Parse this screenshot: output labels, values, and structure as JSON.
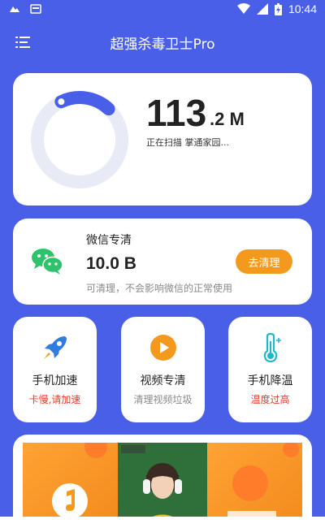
{
  "status_bar": {
    "time": "10:44",
    "icons": [
      "notification-icon",
      "notification-icon",
      "wifi-icon",
      "signal-icon",
      "battery-icon"
    ]
  },
  "header": {
    "title": "超强杀毒卫士Pro",
    "menu_icon": "menu-icon"
  },
  "scan": {
    "size_value": "113",
    "size_unit": ".2 M",
    "status_text": "正在扫描 掌通家园...",
    "progress": 0.12
  },
  "wechat": {
    "title": "微信专清",
    "size": "10.0 B",
    "description": "可清理，不会影响微信的正常使用",
    "button_label": "去清理",
    "icon": "wechat-icon"
  },
  "tiles": [
    {
      "title": "手机加速",
      "subtitle": "卡慢,请加速",
      "subtitle_color": "#e23a2e",
      "icon": "rocket-icon"
    },
    {
      "title": "视频专清",
      "subtitle": "清理视频垃圾",
      "subtitle_color": "#888888",
      "icon": "play-icon"
    },
    {
      "title": "手机降温",
      "subtitle": "温度过高",
      "subtitle_color": "#e23a2e",
      "icon": "thermometer-icon"
    }
  ],
  "colors": {
    "background": "#4a5fe8",
    "accent": "#f39a1e",
    "ring_track": "#e8ebf5",
    "ring_progress": "#4a5fe8",
    "wechat_green": "#2dc26b",
    "rocket_blue": "#2f7de0",
    "thermo_teal": "#1fb8c9"
  }
}
